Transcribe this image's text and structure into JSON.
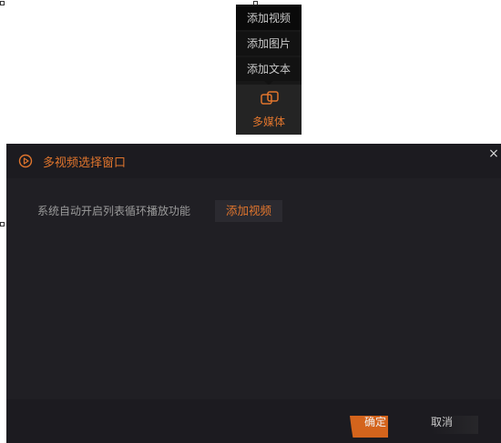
{
  "popup_menu": {
    "items": [
      {
        "label": "添加视频"
      },
      {
        "label": "添加图片"
      },
      {
        "label": "添加文本"
      }
    ],
    "media_button": {
      "label": "多媒体",
      "icon": "multimedia-icon"
    }
  },
  "dialog": {
    "title": "多视频选择窗口",
    "title_icon": "play-circle-icon",
    "close_label": "×",
    "loop_text": "系统自动开启列表循环播放功能",
    "add_video_label": "添加视频",
    "ok_label": "确定",
    "cancel_label": "取消"
  },
  "colors": {
    "accent": "#e0752d",
    "dialog_bg": "#201f24",
    "ok_bg": "#d4641c"
  }
}
